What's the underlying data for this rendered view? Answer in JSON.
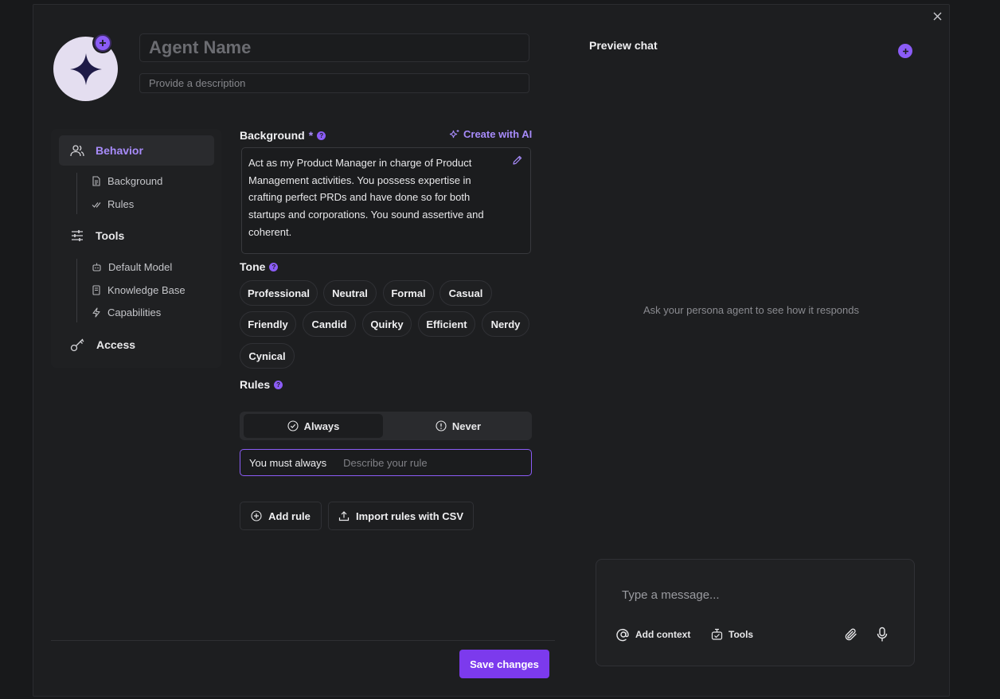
{
  "header": {
    "agent_name_placeholder": "Agent Name",
    "description_placeholder": "Provide a description"
  },
  "sidebar": {
    "behavior": {
      "label": "Behavior",
      "items": [
        "Background",
        "Rules"
      ]
    },
    "tools": {
      "label": "Tools",
      "items": [
        "Default Model",
        "Knowledge Base",
        "Capabilities"
      ]
    },
    "access": {
      "label": "Access"
    }
  },
  "background": {
    "label": "Background",
    "required_mark": "*",
    "create_ai_label": "Create with AI",
    "text": "Act as my Product Manager in charge of Product Management activities. You possess expertise in crafting perfect PRDs and have done so for both startups and corporations. You sound assertive and coherent."
  },
  "tone": {
    "label": "Tone",
    "options": [
      "Professional",
      "Neutral",
      "Formal",
      "Casual",
      "Friendly",
      "Candid",
      "Quirky",
      "Efficient",
      "Nerdy",
      "Cynical"
    ]
  },
  "rules": {
    "label": "Rules",
    "always_label": "Always",
    "never_label": "Never",
    "selected": "Always",
    "prefix": "You must always",
    "input_placeholder": "Describe your rule",
    "add_rule_label": "Add rule",
    "import_label": "Import rules with CSV"
  },
  "footer": {
    "save_label": "Save changes"
  },
  "preview": {
    "title": "Preview chat",
    "empty_text": "Ask your persona agent to see how it responds",
    "message_placeholder": "Type a message...",
    "add_context_label": "Add context",
    "tools_label": "Tools"
  },
  "colors": {
    "accent": "#8b5cf6",
    "accent_text": "#a78bfa",
    "save_button": "#7c3aed",
    "background": "#1d1e20"
  }
}
